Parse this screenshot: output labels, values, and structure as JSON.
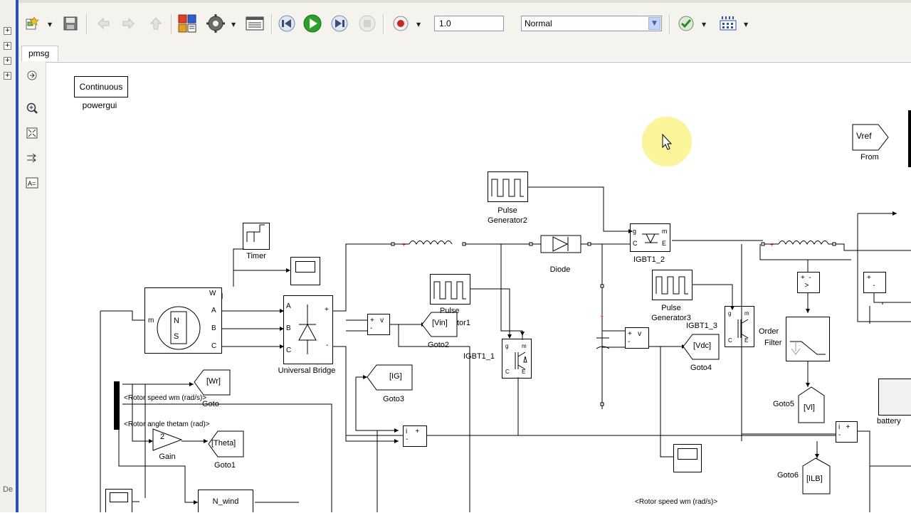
{
  "toolbar": {
    "stop_time": "1.0",
    "sim_mode": "Normal"
  },
  "tab": {
    "label": "pmsg"
  },
  "side_label": "De",
  "blocks": {
    "powergui_box": "Continuous",
    "powergui_name": "powergui",
    "vref": "Vref",
    "from": "From",
    "pulse_gen2": "Pulse\nGenerator2",
    "timer": "Timer",
    "diode": "Diode",
    "igbt1_2": "IGBT1_2",
    "universal_bridge": "Universal Bridge",
    "vin": "[Vin]",
    "goto2": "Goto2",
    "pulse_gen1_a": "Pulse",
    "pulse_gen1_b": "tor1",
    "igbt1_1": "IGBT1_1",
    "pulse_gen3": "Pulse\nGenerator3",
    "igbt1_3": "IGBT1_3",
    "vdc": "[Vdc]",
    "goto4": "Goto4",
    "filter_a": "Order",
    "filter_b": "Filter",
    "goto5": "Goto5",
    "vl": "[Vl]",
    "battery": "battery",
    "wr": "[Wr]",
    "goto": "Goto",
    "rotor_speed": "<Rotor speed wm (rad/s)>",
    "rotor_angle": "<Rotor angle thetam (rad)>",
    "gain_val": "2",
    "gain": "Gain",
    "theta": "[Theta]",
    "goto1": "Goto1",
    "ig": "[IG]",
    "goto3": "Goto3",
    "goto6": "Goto6",
    "ilb": "[ILB]",
    "n_wind": "N_wind",
    "rotor_speed_bottom": "<Rotor speed wm (rad/s)>",
    "machine_m": "m",
    "port_w": "W",
    "port_a": "A",
    "port_b": "B",
    "port_c": "C",
    "ub_a": "A",
    "ub_b": "B",
    "ub_c": "C",
    "ub_plus": "+",
    "ub_minus": "-"
  },
  "colors": {
    "canvas": "#ffffff",
    "toolbar": "#f4f3ee",
    "frame_blue": "#2b4fc0",
    "cursor_highlight": "#fbf59a",
    "play_green": "#2aa22a",
    "record_red": "#d02020"
  },
  "icons": [
    "new-model-icon",
    "save-icon",
    "back-icon",
    "forward-icon",
    "up-icon",
    "library-icon",
    "settings-icon",
    "model-explorer-icon",
    "step-back-icon",
    "play-icon",
    "step-forward-icon",
    "stop-icon",
    "record-icon",
    "check-icon",
    "grid-icon"
  ]
}
